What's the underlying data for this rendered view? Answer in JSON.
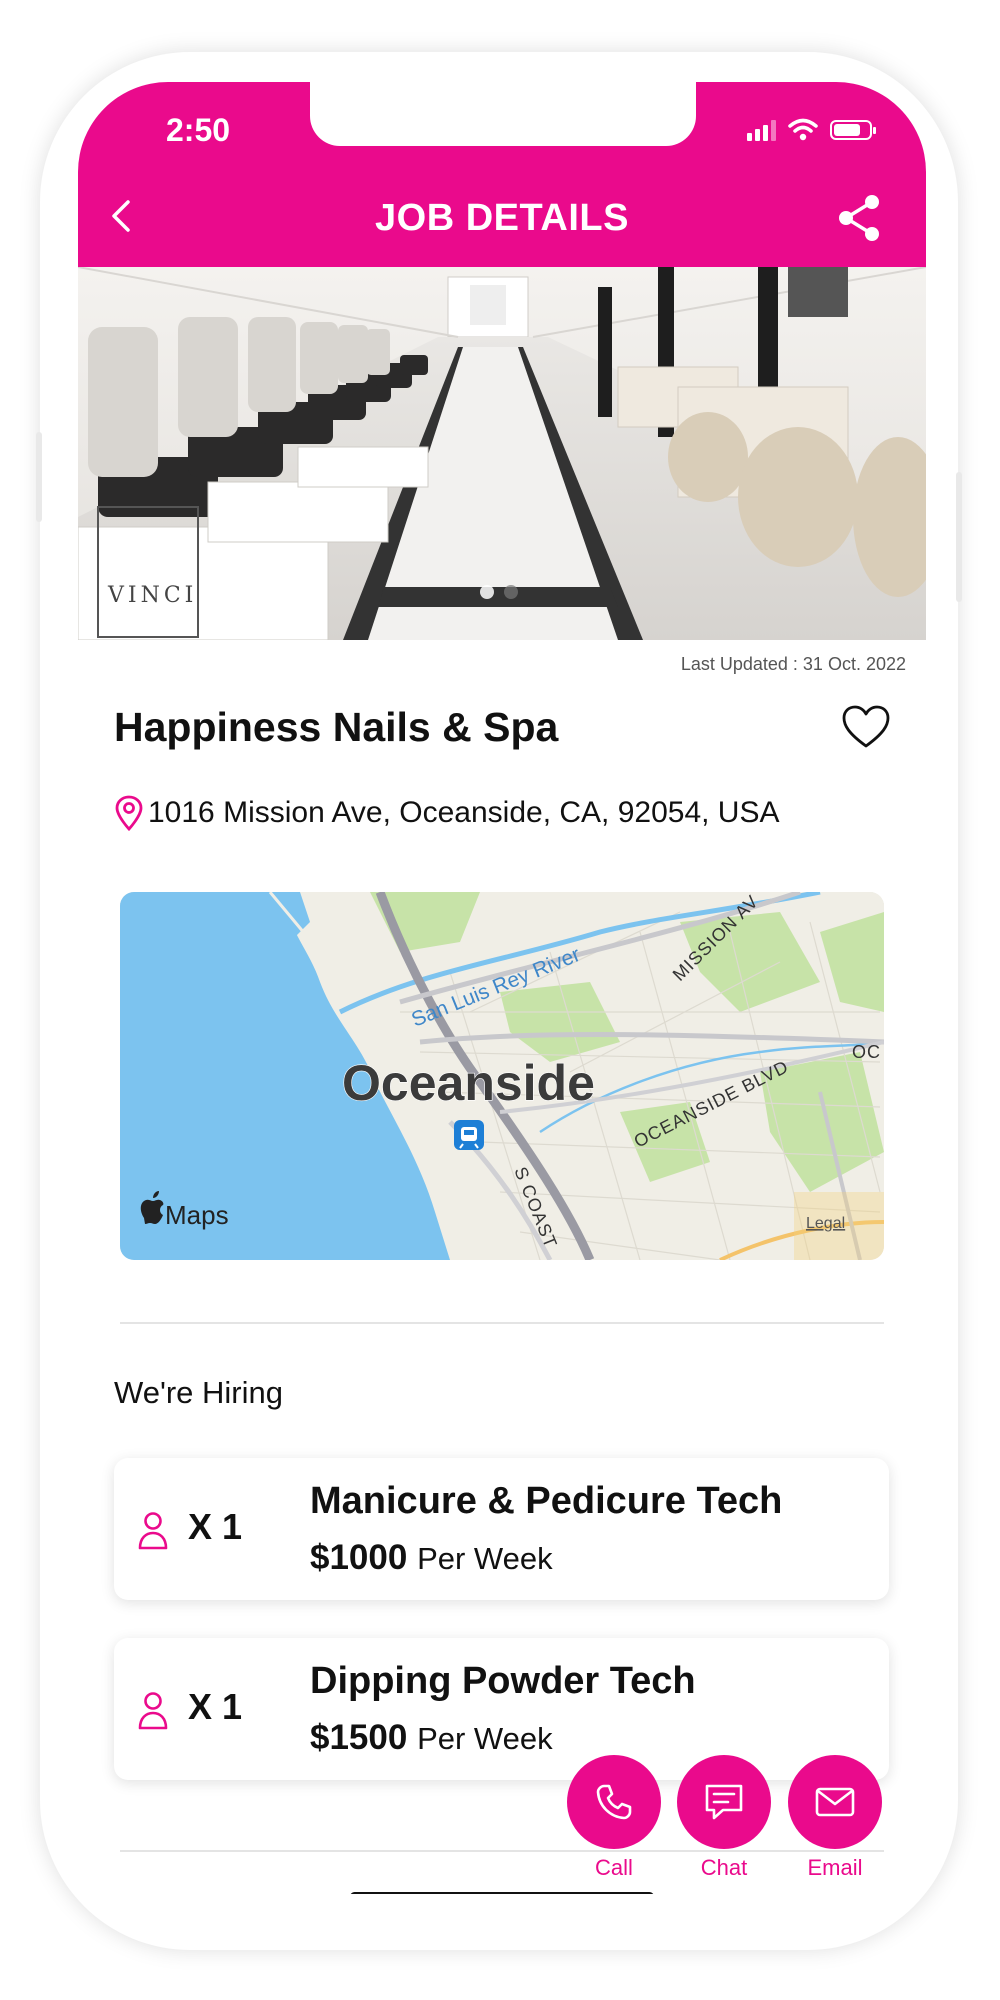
{
  "status_bar": {
    "time": "2:50"
  },
  "header": {
    "title": "JOB DETAILS"
  },
  "hero": {
    "carousel_pages": 2,
    "active_page": 1,
    "watermark": "VINCI"
  },
  "listing": {
    "last_updated": "Last Updated : 31 Oct. 2022",
    "name": "Happiness Nails & Spa",
    "address": "1016 Mission Ave, Oceanside, CA, 92054, USA"
  },
  "map": {
    "city": "Oceanside",
    "river": "San Luis Rey River",
    "street_mission": "MISSION AV",
    "street_oceanside": "OCEANSIDE BLVD",
    "street_oc": "OC",
    "street_coast": "S COAST",
    "brand": "Maps",
    "legal": "Legal"
  },
  "hiring": {
    "label": "We're Hiring",
    "jobs": [
      {
        "count": "X 1",
        "title": "Manicure & Pedicure Tech",
        "pay": "$1000",
        "period": "Per Week"
      },
      {
        "count": "X 1",
        "title": "Dipping Powder Tech",
        "pay": "$1500",
        "period": "Per Week"
      }
    ]
  },
  "actions": {
    "call": "Call",
    "chat": "Chat",
    "email": "Email"
  },
  "colors": {
    "brand": "#ea0a8c",
    "map_water": "#7cc3ef",
    "map_land": "#f0eee6",
    "map_green": "#c7e3a8"
  }
}
